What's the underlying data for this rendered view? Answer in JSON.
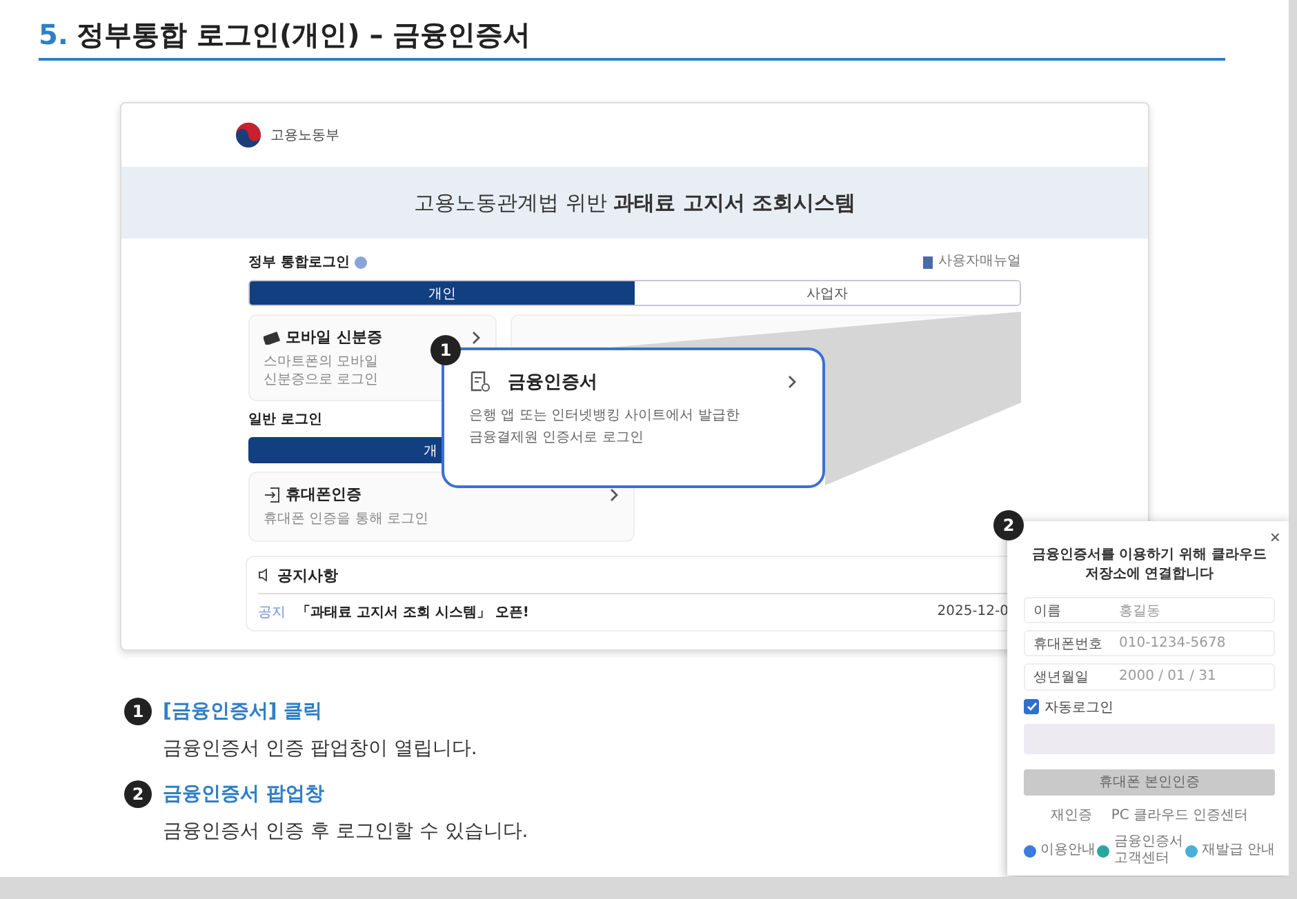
{
  "section": {
    "number": "5.",
    "title": "정부통합 로그인(개인) – 금융인증서"
  },
  "site": {
    "ministry": "고용노동부",
    "banner": "고용노동관계법 위반 **과태료 고지서 조회시스템**",
    "gov_login": {
      "title": "정부 통합로그인",
      "manual": "사용자매뉴얼",
      "tabs": [
        {
          "label": "개인",
          "selected": true
        },
        {
          "label": "사업자",
          "selected": false
        }
      ],
      "methods": [
        {
          "title": "모바일 신분증",
          "description": "스마트폰의 모바일 신분증으로 로그인"
        }
      ]
    },
    "general_login": {
      "title": "일반 로그인",
      "tab": {
        "label": "개",
        "selected": true
      },
      "methods": [
        {
          "title": "휴대폰인증",
          "description": "휴대폰 인증을 통해 로그인"
        }
      ]
    },
    "notice": {
      "title": "공지사항",
      "items": [
        {
          "tag": "공지",
          "text": "「과태료 고지서 조회 시스템」 오픈!",
          "date": "2025-12-0"
        }
      ]
    }
  },
  "callout": {
    "badge": "1",
    "title": "금융인증서",
    "description": "은행 앱 또는 인터넷뱅킹 사이트에서 발급한 금융결제원 인증서로 로그인"
  },
  "popup": {
    "badge": "2",
    "close": "×",
    "title": "금융인증서를 이용하기 위해 클라우드 저장소에 연결합니다",
    "fields": [
      {
        "label": "이름",
        "value": "홍길동"
      },
      {
        "label": "휴대폰번호",
        "value": "010-1234-5678"
      },
      {
        "label": "생년월일",
        "value": "2000 / 01 / 31"
      }
    ],
    "auto_login": {
      "label": "자동로그인",
      "checked": true
    },
    "button": "휴대폰 본인인증",
    "links": [
      "재인증",
      "PC 클라우드 인증센터"
    ],
    "footer": [
      "이용안내",
      "금융인증서 고객센터",
      "재발급 안내"
    ]
  },
  "steps": [
    {
      "number": "1",
      "title": "[금융인증서] 클릭",
      "description": "금융인증서 인증 팝업창이 열립니다."
    },
    {
      "number": "2",
      "title": "금융인증서 팝업창",
      "description": "금융인증서 인증 후 로그인할 수 있습니다."
    }
  ]
}
